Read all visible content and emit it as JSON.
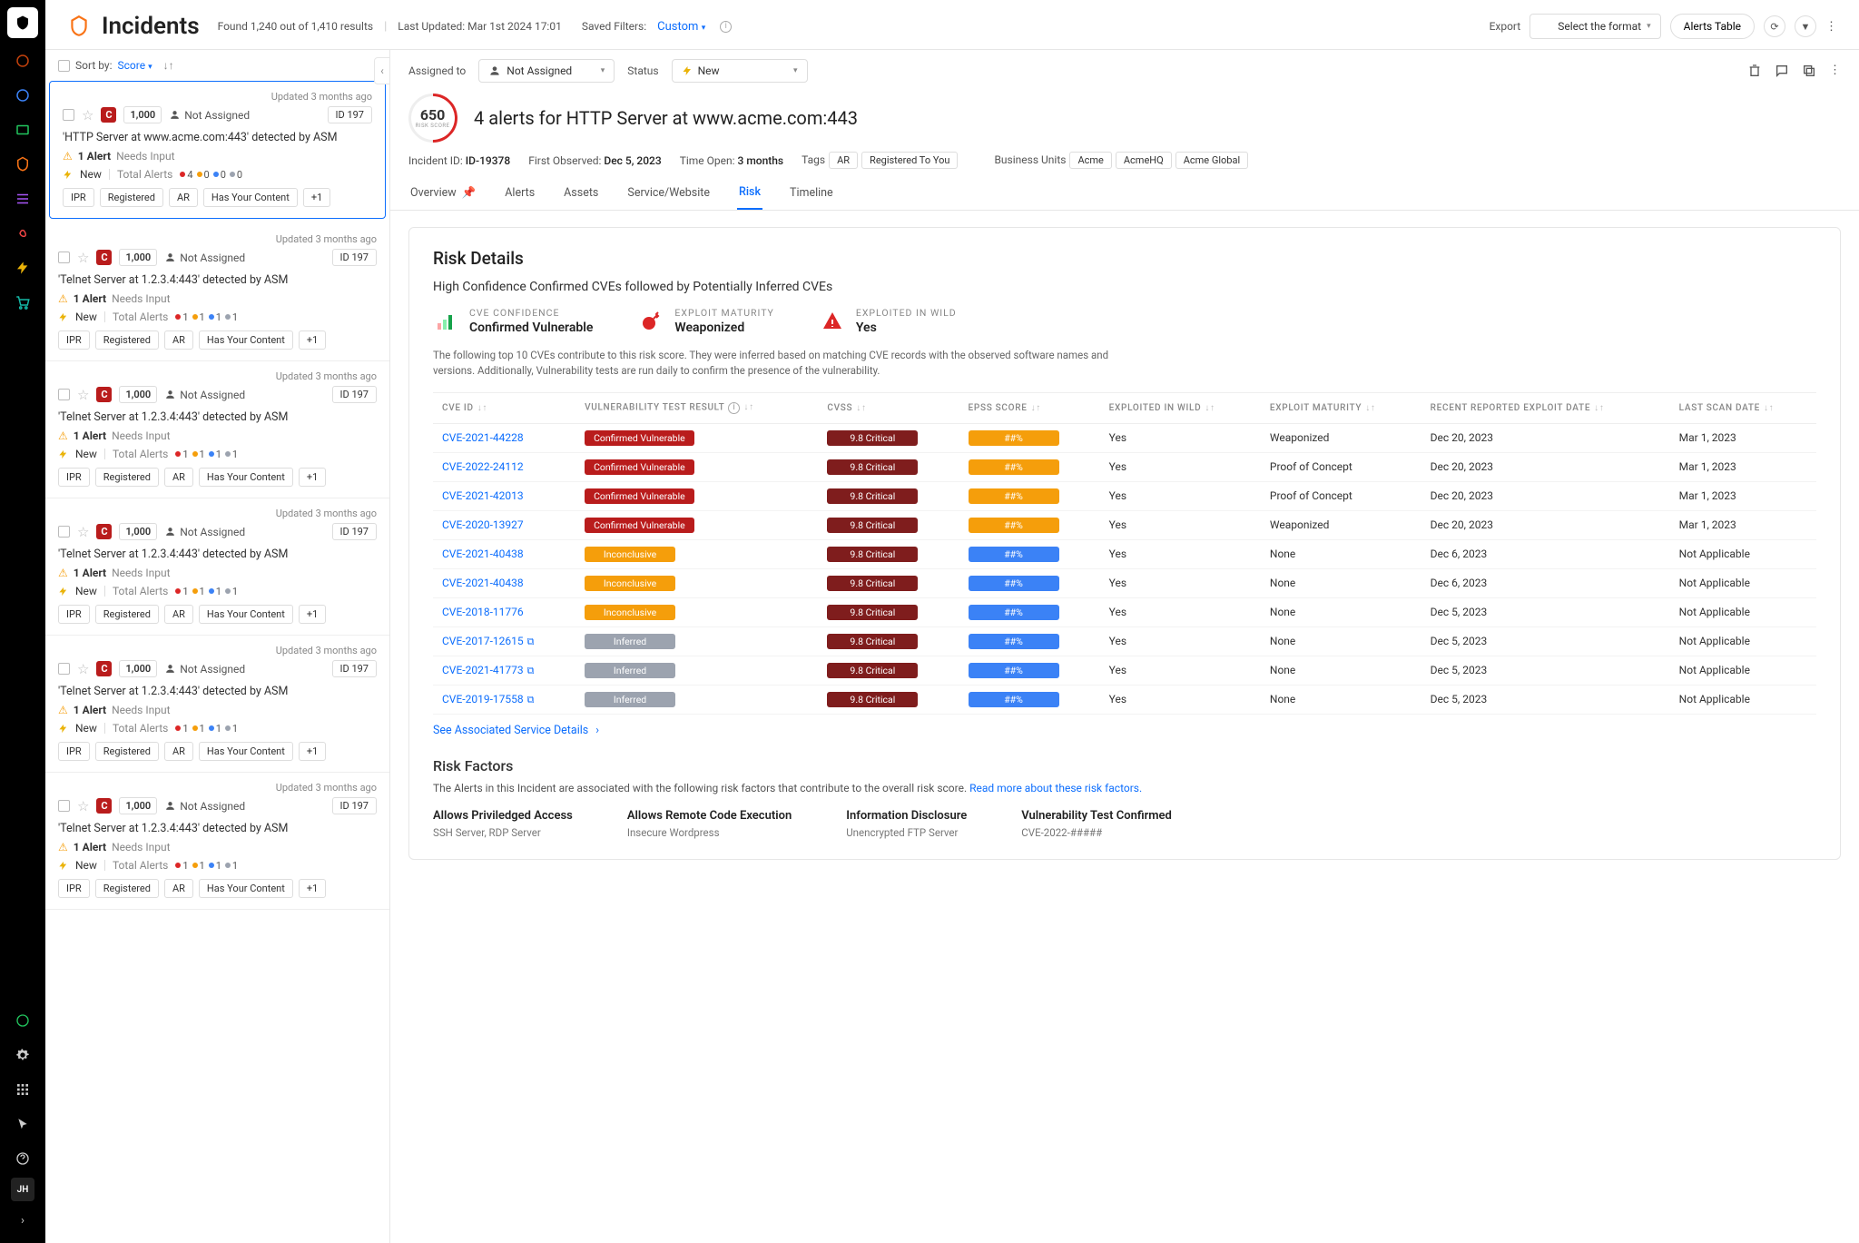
{
  "rail": {
    "avatar": "JH"
  },
  "header": {
    "title": "Incidents",
    "found": "Found 1,240 out of 1,410 results",
    "lastUpdated": "Last Updated: Mar 1st 2024 17:01",
    "savedFiltersLabel": "Saved Filters:",
    "savedFiltersValue": "Custom",
    "exportLabel": "Export",
    "formatPlaceholder": "Select the format",
    "alertsTableBtn": "Alerts Table"
  },
  "sort": {
    "label": "Sort by:",
    "value": "Score"
  },
  "cards": [
    {
      "updated": "Updated 3 months ago",
      "sev": "C",
      "score": "1,000",
      "assignee": "Not Assigned",
      "id": "ID 197",
      "title": "'HTTP Server at www.acme.com:443' detected by ASM",
      "alertCount": "1 Alert",
      "needs": "Needs Input",
      "status": "New",
      "totalLabel": "Total Alerts",
      "dots": [
        {
          "c": "d-red",
          "n": "4"
        },
        {
          "c": "d-orange",
          "n": "0"
        },
        {
          "c": "d-blue",
          "n": "0"
        },
        {
          "c": "d-gray",
          "n": "0"
        }
      ],
      "chips": [
        "IPR",
        "Registered",
        "AR",
        "Has Your Content",
        "+1"
      ],
      "selected": true
    },
    {
      "updated": "Updated 3 months ago",
      "sev": "C",
      "score": "1,000",
      "assignee": "Not Assigned",
      "id": "ID 197",
      "title": "'Telnet Server at 1.2.3.4:443' detected by ASM",
      "alertCount": "1 Alert",
      "needs": "Needs Input",
      "status": "New",
      "totalLabel": "Total Alerts",
      "dots": [
        {
          "c": "d-red",
          "n": "1"
        },
        {
          "c": "d-orange",
          "n": "1"
        },
        {
          "c": "d-blue",
          "n": "1"
        },
        {
          "c": "d-gray",
          "n": "1"
        }
      ],
      "chips": [
        "IPR",
        "Registered",
        "AR",
        "Has Your Content",
        "+1"
      ],
      "selected": false
    },
    {
      "updated": "Updated 3 months ago",
      "sev": "C",
      "score": "1,000",
      "assignee": "Not Assigned",
      "id": "ID 197",
      "title": "'Telnet Server at 1.2.3.4:443' detected by ASM",
      "alertCount": "1 Alert",
      "needs": "Needs Input",
      "status": "New",
      "totalLabel": "Total Alerts",
      "dots": [
        {
          "c": "d-red",
          "n": "1"
        },
        {
          "c": "d-orange",
          "n": "1"
        },
        {
          "c": "d-blue",
          "n": "1"
        },
        {
          "c": "d-gray",
          "n": "1"
        }
      ],
      "chips": [
        "IPR",
        "Registered",
        "AR",
        "Has Your Content",
        "+1"
      ],
      "selected": false
    },
    {
      "updated": "Updated 3 months ago",
      "sev": "C",
      "score": "1,000",
      "assignee": "Not Assigned",
      "id": "ID 197",
      "title": "'Telnet Server at 1.2.3.4:443' detected by ASM",
      "alertCount": "1 Alert",
      "needs": "Needs Input",
      "status": "New",
      "totalLabel": "Total Alerts",
      "dots": [
        {
          "c": "d-red",
          "n": "1"
        },
        {
          "c": "d-orange",
          "n": "1"
        },
        {
          "c": "d-blue",
          "n": "1"
        },
        {
          "c": "d-gray",
          "n": "1"
        }
      ],
      "chips": [
        "IPR",
        "Registered",
        "AR",
        "Has Your Content",
        "+1"
      ],
      "selected": false
    },
    {
      "updated": "Updated 3 months ago",
      "sev": "C",
      "score": "1,000",
      "assignee": "Not Assigned",
      "id": "ID 197",
      "title": "'Telnet Server at 1.2.3.4:443' detected by ASM",
      "alertCount": "1 Alert",
      "needs": "Needs Input",
      "status": "New",
      "totalLabel": "Total Alerts",
      "dots": [
        {
          "c": "d-red",
          "n": "1"
        },
        {
          "c": "d-orange",
          "n": "1"
        },
        {
          "c": "d-blue",
          "n": "1"
        },
        {
          "c": "d-gray",
          "n": "1"
        }
      ],
      "chips": [
        "IPR",
        "Registered",
        "AR",
        "Has Your Content",
        "+1"
      ],
      "selected": false
    },
    {
      "updated": "Updated 3 months ago",
      "sev": "C",
      "score": "1,000",
      "assignee": "Not Assigned",
      "id": "ID 197",
      "title": "'Telnet Server at 1.2.3.4:443' detected by ASM",
      "alertCount": "1 Alert",
      "needs": "Needs Input",
      "status": "New",
      "totalLabel": "Total Alerts",
      "dots": [
        {
          "c": "d-red",
          "n": "1"
        },
        {
          "c": "d-orange",
          "n": "1"
        },
        {
          "c": "d-blue",
          "n": "1"
        },
        {
          "c": "d-gray",
          "n": "1"
        }
      ],
      "chips": [
        "IPR",
        "Registered",
        "AR",
        "Has Your Content",
        "+1"
      ],
      "selected": false
    }
  ],
  "detail": {
    "assignedLabel": "Assigned to",
    "assignedValue": "Not Assigned",
    "statusLabel": "Status",
    "statusValue": "New",
    "riskScore": "650",
    "riskLabel": "RISK SCORE",
    "title": "4 alerts for HTTP Server at www.acme.com:443",
    "incidentIdLabel": "Incident ID:",
    "incidentId": "ID-19378",
    "firstObsLabel": "First Observed:",
    "firstObs": "Dec 5, 2023",
    "timeOpenLabel": "Time Open:",
    "timeOpen": "3 months",
    "tagsLabel": "Tags",
    "tags": [
      "AR",
      "Registered To You"
    ],
    "buLabel": "Business Units",
    "bus": [
      "Acme",
      "AcmeHQ",
      "Acme Global"
    ],
    "tabs": [
      "Overview",
      "Alerts",
      "Assets",
      "Service/Website",
      "Risk",
      "Timeline"
    ],
    "activeTab": "Risk"
  },
  "risk": {
    "title": "Risk Details",
    "subtitle": "High Confidence Confirmed CVEs followed by Potentially Inferred CVEs",
    "summary": [
      {
        "label": "CVE CONFIDENCE",
        "value": "Confirmed Vulnerable",
        "icon": "bars",
        "color": "#16a34a"
      },
      {
        "label": "EXPLOIT MATURITY",
        "value": "Weaponized",
        "icon": "bomb",
        "color": "#dc2626"
      },
      {
        "label": "EXPLOITED IN WILD",
        "value": "Yes",
        "icon": "warn",
        "color": "#dc2626"
      }
    ],
    "intro": "The following top 10 CVEs contribute to this risk score. They were inferred based on matching CVE records with the observed software names and versions. Additionally, Vulnerability tests are run daily to confirm the presence of the vulnerability.",
    "columns": [
      "CVE ID",
      "VULNERABILITY TEST RESULT",
      "CVSS",
      "EPSS SCORE",
      "EXPLOITED IN WILD",
      "EXPLOIT MATURITY",
      "RECENT REPORTED EXPLOIT DATE",
      "LAST SCAN DATE"
    ],
    "rows": [
      {
        "cve": "CVE-2021-44228",
        "ext": false,
        "test": "Confirmed Vulnerable",
        "testClass": "p-red",
        "cvss": "9.8 Critical",
        "epss": "##%",
        "epssClass": "p-orange",
        "wild": "Yes",
        "mat": "Weaponized",
        "reported": "Dec 20, 2023",
        "scan": "Mar 1, 2023"
      },
      {
        "cve": "CVE-2022-24112",
        "ext": false,
        "test": "Confirmed Vulnerable",
        "testClass": "p-red",
        "cvss": "9.8 Critical",
        "epss": "##%",
        "epssClass": "p-orange",
        "wild": "Yes",
        "mat": "Proof of Concept",
        "reported": "Dec 20, 2023",
        "scan": "Mar 1, 2023"
      },
      {
        "cve": "CVE-2021-42013",
        "ext": false,
        "test": "Confirmed Vulnerable",
        "testClass": "p-red",
        "cvss": "9.8 Critical",
        "epss": "##%",
        "epssClass": "p-orange",
        "wild": "Yes",
        "mat": "Proof of Concept",
        "reported": "Dec 20, 2023",
        "scan": "Mar 1, 2023"
      },
      {
        "cve": "CVE-2020-13927",
        "ext": false,
        "test": "Confirmed Vulnerable",
        "testClass": "p-red",
        "cvss": "9.8 Critical",
        "epss": "##%",
        "epssClass": "p-orange",
        "wild": "Yes",
        "mat": "Weaponized",
        "reported": "Dec 20, 2023",
        "scan": "Mar 1, 2023"
      },
      {
        "cve": "CVE-2021-40438",
        "ext": false,
        "test": "Inconclusive",
        "testClass": "p-orange",
        "cvss": "9.8 Critical",
        "epss": "##%",
        "epssClass": "p-blue",
        "wild": "Yes",
        "mat": "None",
        "reported": "Dec 6, 2023",
        "scan": "Not Applicable"
      },
      {
        "cve": "CVE-2021-40438",
        "ext": false,
        "test": "Inconclusive",
        "testClass": "p-orange",
        "cvss": "9.8 Critical",
        "epss": "##%",
        "epssClass": "p-blue",
        "wild": "Yes",
        "mat": "None",
        "reported": "Dec 6, 2023",
        "scan": "Not Applicable"
      },
      {
        "cve": "CVE-2018-11776",
        "ext": false,
        "test": "Inconclusive",
        "testClass": "p-orange",
        "cvss": "9.8 Critical",
        "epss": "##%",
        "epssClass": "p-blue",
        "wild": "Yes",
        "mat": "None",
        "reported": "Dec 5, 2023",
        "scan": "Not Applicable"
      },
      {
        "cve": "CVE-2017-12615",
        "ext": true,
        "test": "Inferred",
        "testClass": "p-gray",
        "cvss": "9.8 Critical",
        "epss": "##%",
        "epssClass": "p-blue",
        "wild": "Yes",
        "mat": "None",
        "reported": "Dec 5, 2023",
        "scan": "Not Applicable"
      },
      {
        "cve": "CVE-2021-41773",
        "ext": true,
        "test": "Inferred",
        "testClass": "p-gray",
        "cvss": "9.8 Critical",
        "epss": "##%",
        "epssClass": "p-blue",
        "wild": "Yes",
        "mat": "None",
        "reported": "Dec 5, 2023",
        "scan": "Not Applicable"
      },
      {
        "cve": "CVE-2019-17558",
        "ext": true,
        "test": "Inferred",
        "testClass": "p-gray",
        "cvss": "9.8 Critical",
        "epss": "##%",
        "epssClass": "p-blue",
        "wild": "Yes",
        "mat": "None",
        "reported": "Dec 5, 2023",
        "scan": "Not Applicable"
      }
    ],
    "seeLink": "See Associated Service Details",
    "rfTitle": "Risk Factors",
    "rfIntro": "The Alerts in this Incident are associated with the following risk factors that contribute to the overall risk score. ",
    "rfLink": "Read more about these risk factors.",
    "factors": [
      {
        "t": "Allows Priviledged Access",
        "d": "SSH Server, RDP Server"
      },
      {
        "t": "Allows Remote Code Execution",
        "d": "Insecure Wordpress"
      },
      {
        "t": "Information Disclosure",
        "d": "Unencrypted FTP Server"
      },
      {
        "t": "Vulnerability Test Confirmed",
        "d": "CVE-2022-#####"
      }
    ]
  }
}
